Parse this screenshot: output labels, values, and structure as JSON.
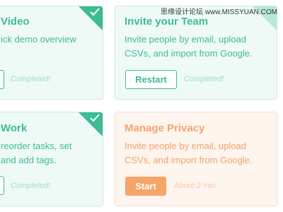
{
  "cards": [
    {
      "title": "Video",
      "lines": [
        "ick demo overview"
      ],
      "status": "Completed!"
    },
    {
      "title": "Invite your Team",
      "lines": [
        "Invite people by email, upload",
        "CSVs, and import from Google."
      ],
      "button": "Restart",
      "status": "Completed!"
    },
    {
      "title": "Work",
      "lines": [
        "reorder tasks, set",
        "and add tags."
      ],
      "status": "Completed!"
    },
    {
      "title": "Manage Privacy",
      "lines": [
        "Invite people by email, upload",
        "CSVs, and import from Google."
      ],
      "button": "Start",
      "status": "About 2 min"
    }
  ],
  "watermark": "思缘设计论坛  www.MISSYUAN.COM",
  "colors": {
    "completed_accent": "#3dbb94",
    "pending_accent": "#f7a468",
    "completed_bg": "#effaf6",
    "pending_bg": "#fff5ef"
  },
  "icons": {
    "completed_badge": "checkmark-icon"
  }
}
